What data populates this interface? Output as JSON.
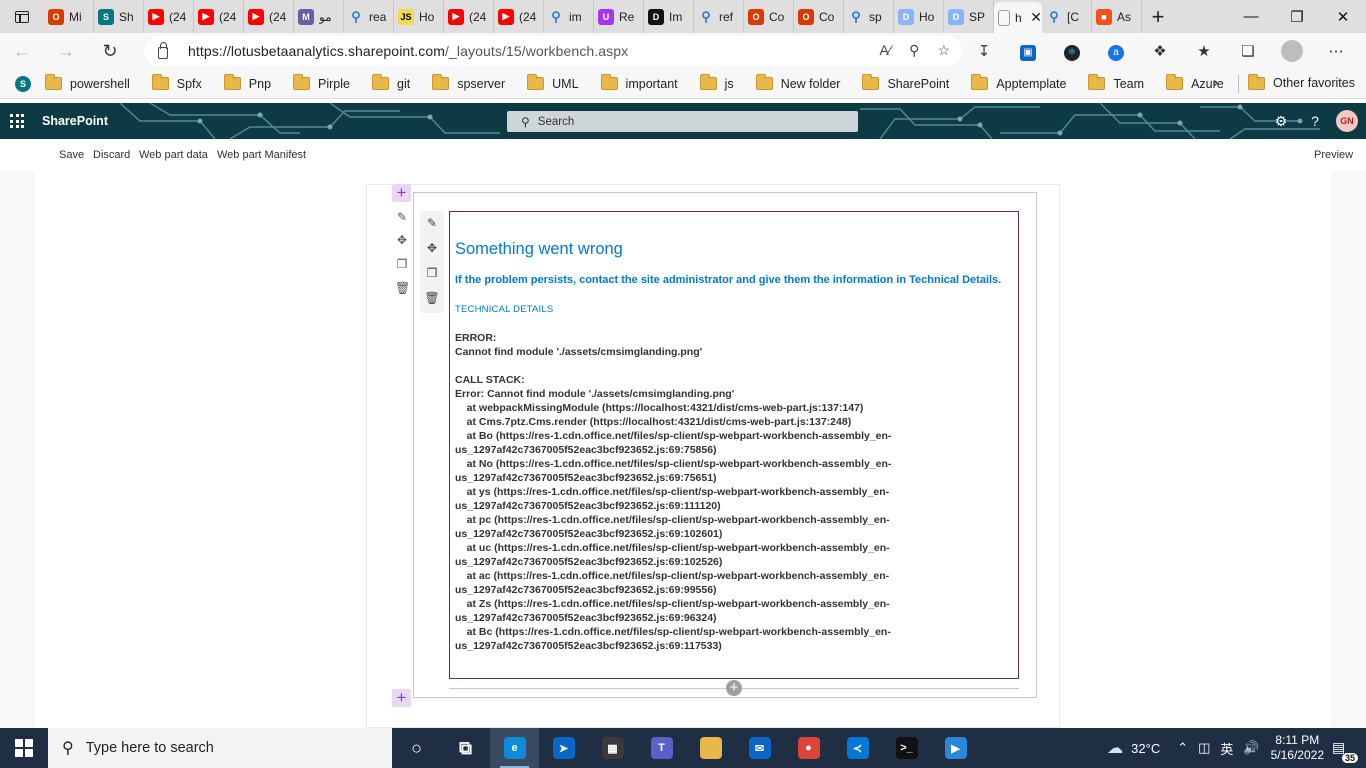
{
  "browser": {
    "tabs": [
      {
        "icon": "office-icon",
        "title": "Mi",
        "color": "#d83b01",
        "glyph": "O"
      },
      {
        "icon": "sharepoint-icon",
        "title": "Sh",
        "color": "#03787c",
        "glyph": "S"
      },
      {
        "icon": "youtube-icon",
        "title": "(24",
        "color": "#ff0000",
        "glyph": "▶"
      },
      {
        "icon": "youtube-icon",
        "title": "(24",
        "color": "#ff0000",
        "glyph": "▶"
      },
      {
        "icon": "youtube-icon",
        "title": "(24",
        "color": "#ff0000",
        "glyph": "▶"
      },
      {
        "icon": "image-icon",
        "title": "مو",
        "color": "#6b5ca5",
        "glyph": "M"
      },
      {
        "icon": "search-icon",
        "title": "rea",
        "color": "#2b7bd6",
        "glyph": "⚲"
      },
      {
        "icon": "js-icon",
        "title": "Ho",
        "color": "#f0db4f",
        "glyph": "JS"
      },
      {
        "icon": "youtube-icon",
        "title": "(24",
        "color": "#ff0000",
        "glyph": "▶"
      },
      {
        "icon": "youtube-icon",
        "title": "(24",
        "color": "#ff0000",
        "glyph": "▶"
      },
      {
        "icon": "search-icon",
        "title": "im",
        "color": "#2b7bd6",
        "glyph": "⚲"
      },
      {
        "icon": "udemy-icon",
        "title": "Re",
        "color": "#a435f0",
        "glyph": "U"
      },
      {
        "icon": "dev-icon",
        "title": "Im",
        "color": "#111111",
        "glyph": "D"
      },
      {
        "icon": "search-icon",
        "title": "ref",
        "color": "#2b7bd6",
        "glyph": "⚲"
      },
      {
        "icon": "office-icon",
        "title": "Co",
        "color": "#d83b01",
        "glyph": "O"
      },
      {
        "icon": "office-icon",
        "title": "Co",
        "color": "#d83b01",
        "glyph": "O"
      },
      {
        "icon": "search-icon",
        "title": "sp",
        "color": "#2b7bd6",
        "glyph": "⚲"
      },
      {
        "icon": "docs-icon",
        "title": "Ho",
        "color": "#8ab4f8",
        "glyph": "D"
      },
      {
        "icon": "docs-icon",
        "title": "SP",
        "color": "#8ab4f8",
        "glyph": "D"
      },
      {
        "icon": "page-icon",
        "title": "htt",
        "color": "#e6e6e6",
        "glyph": "",
        "active": true
      },
      {
        "icon": "search-icon",
        "title": "[C",
        "color": "#2b7bd6",
        "glyph": "⚲"
      },
      {
        "icon": "microsoft-icon",
        "title": "As",
        "color": "#f25022",
        "glyph": "■"
      }
    ],
    "url_host": "https://lotusbetaanalytics.sharepoint.com",
    "url_path": "/_layouts/15/workbench.aspx",
    "favorites": [
      "powershell",
      "Spfx",
      "Pnp",
      "Pirple",
      "git",
      "spserver",
      "UML",
      "important",
      "js",
      "New folder",
      "SharePoint",
      "Apptemplate",
      "Team",
      "Azure"
    ],
    "other_favorites": "Other favorites"
  },
  "sharepoint": {
    "title": "SharePoint",
    "search_placeholder": "Search",
    "avatar_initials": "GN"
  },
  "workbench": {
    "commands": [
      "Save",
      "Discard",
      "Web part data",
      "Web part Manifest"
    ],
    "preview": "Preview"
  },
  "error": {
    "title": "Something went wrong",
    "subtitle": "If the problem persists, contact the site administrator and give them the information in Technical Details.",
    "technical_details": "TECHNICAL DETAILS",
    "error_label": "ERROR:",
    "error_message": "Cannot find module './assets/cmsimglanding.png'",
    "callstack_label": "CALL STACK:",
    "callstack": [
      "Error: Cannot find module './assets/cmsimglanding.png'",
      "    at webpackMissingModule (https://localhost:4321/dist/cms-web-part.js:137:147)",
      "    at Cms.7ptz.Cms.render (https://localhost:4321/dist/cms-web-part.js:137:248)",
      "    at Bo (https://res-1.cdn.office.net/files/sp-client/sp-webpart-workbench-assembly_en-",
      "us_1297af42c7367005f52eac3bcf923652.js:69:75856)",
      "    at No (https://res-1.cdn.office.net/files/sp-client/sp-webpart-workbench-assembly_en-",
      "us_1297af42c7367005f52eac3bcf923652.js:69:75651)",
      "    at ys (https://res-1.cdn.office.net/files/sp-client/sp-webpart-workbench-assembly_en-",
      "us_1297af42c7367005f52eac3bcf923652.js:69:111120)",
      "    at pc (https://res-1.cdn.office.net/files/sp-client/sp-webpart-workbench-assembly_en-",
      "us_1297af42c7367005f52eac3bcf923652.js:69:102601)",
      "    at uc (https://res-1.cdn.office.net/files/sp-client/sp-webpart-workbench-assembly_en-",
      "us_1297af42c7367005f52eac3bcf923652.js:69:102526)",
      "    at ac (https://res-1.cdn.office.net/files/sp-client/sp-webpart-workbench-assembly_en-",
      "us_1297af42c7367005f52eac3bcf923652.js:69:99556)",
      "    at Zs (https://res-1.cdn.office.net/files/sp-client/sp-webpart-workbench-assembly_en-",
      "us_1297af42c7367005f52eac3bcf923652.js:69:96324)",
      "    at Bc (https://res-1.cdn.office.net/files/sp-client/sp-webpart-workbench-assembly_en-",
      "us_1297af42c7367005f52eac3bcf923652.js:69:117533)"
    ]
  },
  "taskbar": {
    "search_placeholder": "Type here to search",
    "apps": [
      {
        "icon": "cortana-icon",
        "color": "transparent",
        "glyph": "○"
      },
      {
        "icon": "task-view-icon",
        "color": "transparent",
        "glyph": "⧉"
      },
      {
        "icon": "edge-icon",
        "color": "#0c8bd6",
        "glyph": "e",
        "active": true
      },
      {
        "icon": "power-automate-icon",
        "color": "#0a66c2",
        "glyph": "➤"
      },
      {
        "icon": "store-icon",
        "color": "#3a3a3a",
        "glyph": "▦"
      },
      {
        "icon": "teams-icon",
        "color": "#5b5fc7",
        "glyph": "T"
      },
      {
        "icon": "file-explorer-icon",
        "color": "#e8b84a",
        "glyph": ""
      },
      {
        "icon": "mail-icon",
        "color": "#0a66c2",
        "glyph": "✉"
      },
      {
        "icon": "chrome-icon",
        "color": "#db4437",
        "glyph": "●"
      },
      {
        "icon": "vscode-icon",
        "color": "#0078d4",
        "glyph": "≺"
      },
      {
        "icon": "terminal-icon",
        "color": "#111111",
        "glyph": ">_"
      },
      {
        "icon": "video-editor-icon",
        "color": "#2b88d8",
        "glyph": "▶"
      }
    ],
    "temperature": "32°C",
    "ime": "英",
    "time": "8:11 PM",
    "date": "5/16/2022",
    "notifications": "35"
  }
}
